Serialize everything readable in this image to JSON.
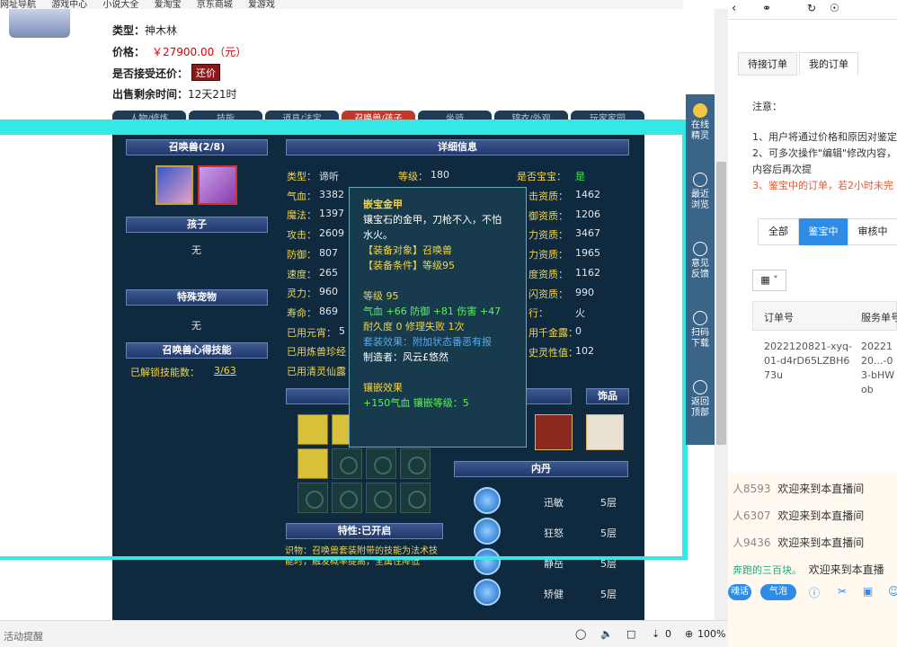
{
  "bookmarks": [
    "网址导航",
    "游戏中心",
    "小说大全",
    "爱淘宝",
    "京东商城",
    "爱游戏"
  ],
  "product": {
    "type_label": "类型：",
    "type_value": "神木林",
    "price_label": "价格：",
    "price_value": "￥27900.00（元）",
    "haggle_label": "是否接受还价：",
    "haggle_button": "还价",
    "time_label": "出售剩余时间：",
    "time_value": "12天21时"
  },
  "tabs": [
    "人物/修炼",
    "技能",
    "道具/法宝",
    "召唤兽/孩子",
    "坐骑",
    "锦衣/外观",
    "玩家家园"
  ],
  "game": {
    "summon_header": "召唤兽(2/8)",
    "child_header": "孩子",
    "child_value": "无",
    "special_header": "特殊宠物",
    "special_value": "无",
    "skill_header": "召唤兽心得技能",
    "unlocked_label": "已解锁技能数：",
    "unlocked_value": "3/63",
    "detail_header": "详细信息",
    "stats_left": [
      {
        "label": "类型：",
        "value": "谛听"
      },
      {
        "label": "气血：",
        "value": "3382"
      },
      {
        "label": "魔法：",
        "value": "1397"
      },
      {
        "label": "攻击：",
        "value": "2609"
      },
      {
        "label": "防御：",
        "value": "807"
      },
      {
        "label": "速度：",
        "value": "265"
      },
      {
        "label": "灵力：",
        "value": "960"
      },
      {
        "label": "寿命：",
        "value": "869"
      },
      {
        "label": "已用元宵：",
        "value": "5"
      },
      {
        "label": "已用炼兽珍经",
        "value": ""
      },
      {
        "label": "已用清灵仙露",
        "value": ""
      }
    ],
    "level_label": "等级：",
    "level_value": "180",
    "baby_label": "是否宝宝：",
    "baby_value": "是",
    "stats_right": [
      {
        "label": "击资质：",
        "value": "1462"
      },
      {
        "label": "御资质：",
        "value": "1206"
      },
      {
        "label": "力资质：",
        "value": "3467"
      },
      {
        "label": "力资质：",
        "value": "1965"
      },
      {
        "label": "度资质：",
        "value": "1162"
      },
      {
        "label": "闪资质：",
        "value": "990"
      },
      {
        "label": "行：",
        "value": "火"
      },
      {
        "label": "用千金露：",
        "value": "0"
      },
      {
        "label": "史灵性值：",
        "value": "102"
      }
    ],
    "jewelry_header": "饰品",
    "neidan_header": "内丹",
    "neidan": [
      {
        "name": "迅敏",
        "level": "5层"
      },
      {
        "name": "狂怒",
        "level": "5层"
      },
      {
        "name": "静岳",
        "level": "5层"
      },
      {
        "name": "矫健",
        "level": "5层"
      }
    ],
    "trait_header": "特性:已开启",
    "trait_line1": "识物：召唤兽套装附带的技能为法术技",
    "trait_line2": "能时，触发概率提高，全属性降低"
  },
  "tooltip": {
    "title": "嵌宝金甲",
    "desc1": "镶宝石的金甲，刀枪不入，不怕",
    "desc2": "水火。",
    "target": "【装备对象】召唤兽",
    "cond": "【装备条件】等级95",
    "level": "等级 95",
    "stats": "气血 +66 防御 +81 伤害 +47",
    "durability": "耐久度 0  修理失败 1次",
    "set": "套装效果：附加状态番恶有报",
    "maker": "制造者：风云£悠然",
    "inlay_title": "镶嵌效果",
    "inlay": "+150气血 镶嵌等级：5"
  },
  "sidenav": [
    {
      "icon": "avatar-icon",
      "label1": "在线",
      "label2": "精灵"
    },
    {
      "icon": "clock-icon",
      "label1": "最近",
      "label2": "浏览"
    },
    {
      "icon": "edit-icon",
      "label1": "意见",
      "label2": "反馈"
    },
    {
      "icon": "scan-icon",
      "label1": "扫码",
      "label2": "下载"
    },
    {
      "icon": "arrow-up-icon",
      "label1": "返回",
      "label2": "顶部"
    }
  ],
  "statusbar": {
    "zoom": "100%",
    "count": "0",
    "left_text": "活动提醒"
  },
  "right": {
    "tab1": "待接订单",
    "tab2": "我的订单",
    "note_title": "注意：",
    "note1": "1、用户将通过价格和原因对鉴定",
    "note2": "2、可多次操作\"编辑\"修改内容，",
    "note3": "内容后再次提",
    "note4": "3、鉴宝中的订单，若2小时未完",
    "filters": [
      "全部",
      "鉴宝中",
      "审核中"
    ],
    "col1": "订单号",
    "col2": "服务单号",
    "order1": "2022120821-xyq-01-d4rD65LZBH673u",
    "order2": "2022120...-03-bHWob"
  },
  "live": {
    "msgs": [
      {
        "user": "人8593",
        "text": "欢迎来到本直播间"
      },
      {
        "user": "人6307",
        "text": "欢迎来到本直播间"
      },
      {
        "user": "人9436",
        "text": "欢迎来到本直播间"
      },
      {
        "user": "奔跑的三百块。",
        "text": "欢迎来到本直播"
      }
    ],
    "btn1": "魂话",
    "btn2": "气泡"
  }
}
